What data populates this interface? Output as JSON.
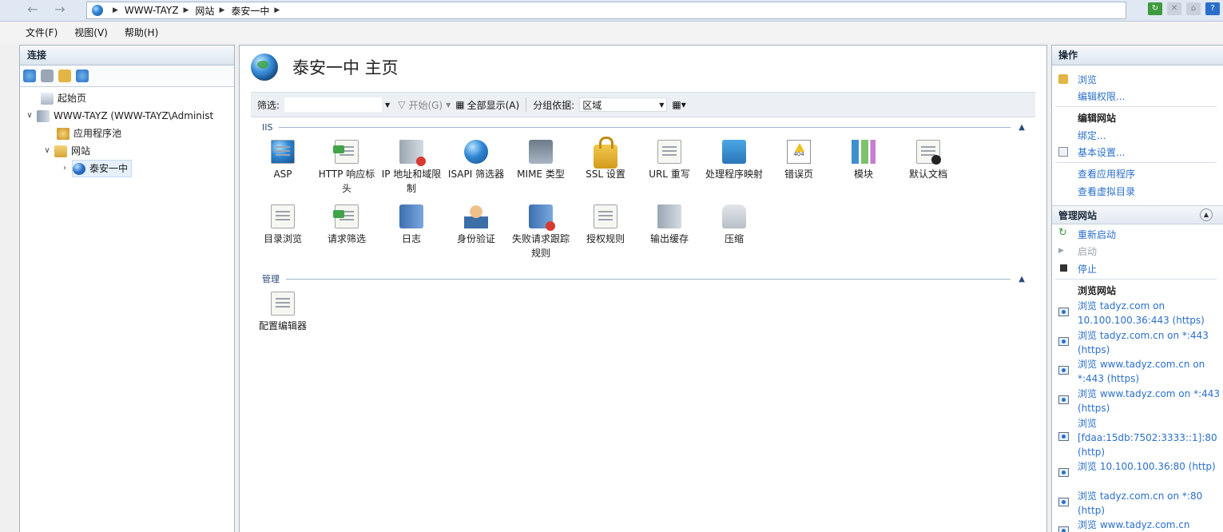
{
  "address": {
    "back_icon": "back-arrow-icon",
    "forward_icon": "forward-arrow-icon",
    "breadcrumb": [
      "WWW-TAYZ",
      "网站",
      "泰安一中"
    ]
  },
  "menu": [
    "文件(F)",
    "视图(V)",
    "帮助(H)"
  ],
  "connections": {
    "title": "连接",
    "tree": {
      "start_page": "起始页",
      "server": "WWW-TAYZ (WWW-TAYZ\\Administ",
      "app_pools": "应用程序池",
      "sites": "网站",
      "site": "泰安一中"
    }
  },
  "center": {
    "title": "泰安一中 主页",
    "filter_label": "筛选:",
    "filter_value": "",
    "start_button": "开始(G)",
    "show_all_button": "全部显示(A)",
    "group_by_label": "分组依据:",
    "group_by_value": "区域",
    "sections": {
      "iis": {
        "label": "IIS",
        "features": [
          {
            "name": "ASP",
            "icon": "asp-page-icon"
          },
          {
            "name": "HTTP 响应标头",
            "icon": "http-headers-icon"
          },
          {
            "name": "IP 地址和域限制",
            "icon": "ip-restrictions-icon"
          },
          {
            "name": "ISAPI 筛选器",
            "icon": "isapi-filter-icon"
          },
          {
            "name": "MIME 类型",
            "icon": "mime-types-icon"
          },
          {
            "name": "SSL 设置",
            "icon": "lock-icon"
          },
          {
            "name": "URL 重写",
            "icon": "url-rewrite-icon"
          },
          {
            "name": "处理程序映射",
            "icon": "handler-mappings-icon"
          },
          {
            "name": "错误页",
            "icon": "error-page-icon"
          },
          {
            "name": "模块",
            "icon": "modules-icon"
          },
          {
            "name": "默认文档",
            "icon": "default-document-icon"
          },
          {
            "name": "目录浏览",
            "icon": "directory-browsing-icon"
          },
          {
            "name": "请求筛选",
            "icon": "request-filtering-icon"
          },
          {
            "name": "日志",
            "icon": "logging-icon"
          },
          {
            "name": "身份验证",
            "icon": "authentication-icon"
          },
          {
            "name": "失败请求跟踪规则",
            "icon": "failed-request-tracing-icon"
          },
          {
            "name": "授权规则",
            "icon": "authorization-rules-icon"
          },
          {
            "name": "输出缓存",
            "icon": "output-caching-icon"
          },
          {
            "name": "压缩",
            "icon": "compression-icon"
          }
        ]
      },
      "management": {
        "label": "管理",
        "features": [
          {
            "name": "配置编辑器",
            "icon": "configuration-editor-icon"
          }
        ]
      }
    }
  },
  "actions": {
    "title": "操作",
    "explore": "浏览",
    "edit_permissions": "编辑权限...",
    "edit_site_header": "编辑网站",
    "bindings": "绑定...",
    "basic_settings": "基本设置...",
    "view_applications": "查看应用程序",
    "view_virtual_dirs": "查看虚拟目录",
    "manage_site_header": "管理网站",
    "restart": "重新启动",
    "start": "启动",
    "stop": "停止",
    "browse_site_header": "浏览网站",
    "browse_links": [
      "浏览 tadyz.com on 10.100.100.36:443 (https)",
      "浏览 tadyz.com.cn on *:443 (https)",
      "浏览 www.tadyz.com.cn on *:443 (https)",
      "浏览 www.tadyz.com on *:443 (https)",
      "浏览 [fdaa:15db:7502:3333::1]:80 (http)",
      "浏览 10.100.100.36:80 (http)",
      "浏览 tadyz.com.cn on *:80 (http)",
      "浏览 www.tadyz.com.cn"
    ]
  }
}
